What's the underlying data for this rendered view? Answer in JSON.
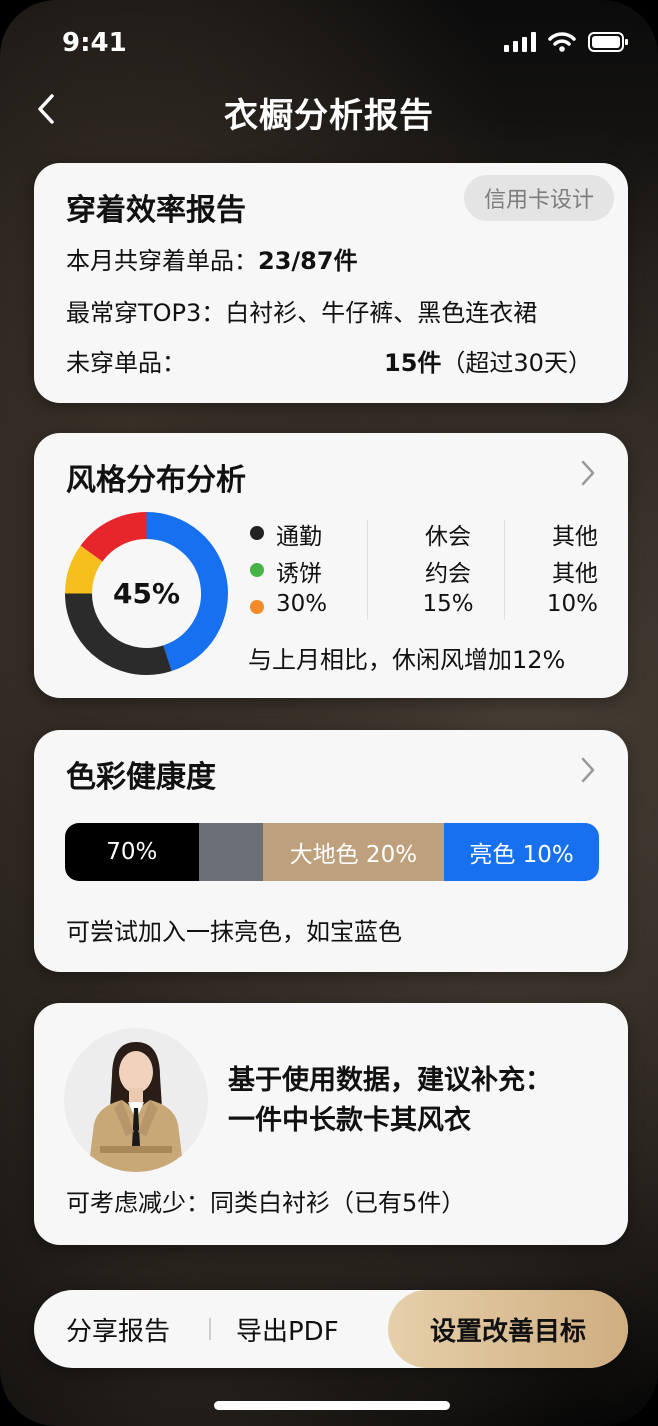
{
  "status_bar": {
    "time": "9:41"
  },
  "nav": {
    "title": "衣橱分析报告"
  },
  "efficiency": {
    "title": "穿着效率报告",
    "badge": "信用卡设计",
    "worn_label": "本月共穿着单品：",
    "worn_value": "23/87件",
    "top3_label": "最常穿TOP3：",
    "top3_value": "白衬衫、牛仔裤、黑色连衣裙",
    "unworn_label": "未穿单品：",
    "unworn_value": "15件",
    "unworn_note": "（超过30天）"
  },
  "style": {
    "title": "风格分布分析",
    "center_value": "45%",
    "rows": [
      {
        "c1": "通勤",
        "c2": "休会",
        "c3": "其他",
        "dot_color": "#222222"
      },
      {
        "c1": "诱饼",
        "c2": "约会",
        "c3": "其他",
        "dot_color": "#47b347"
      },
      {
        "c1": "30%",
        "c2": "15%",
        "c3": "10%",
        "dot_color": "#f28a2a"
      }
    ],
    "compare": "与上月相比，休闲风增加12%",
    "donut_segments": [
      {
        "color": "#1670f0",
        "value": 45
      },
      {
        "color": "#2b2b2b",
        "value": 30
      },
      {
        "color": "#f7bf1e",
        "value": 10
      },
      {
        "color": "#e7262c",
        "value": 15
      }
    ]
  },
  "color_health": {
    "title": "色彩健康度",
    "segments": [
      {
        "label": "70%",
        "color": "#000000",
        "value": 25
      },
      {
        "label": "",
        "color": "#6b6e75",
        "value": 12
      },
      {
        "label": "大地色 20%",
        "color": "#bea07c",
        "value": 34
      },
      {
        "label": "亮色 10%",
        "color": "#1670f0",
        "value": 29
      }
    ],
    "tip": "可尝试加入一抹亮色，如宝蓝色"
  },
  "suggest": {
    "line1": "基于使用数据，建议补充：",
    "line2": "一件中长款卡其风衣",
    "reduce": "可考虑减少：同类白衬衫（已有5件）"
  },
  "actions": {
    "share": "分享报告",
    "export": "导出PDF",
    "goal": "设置改善目标"
  }
}
